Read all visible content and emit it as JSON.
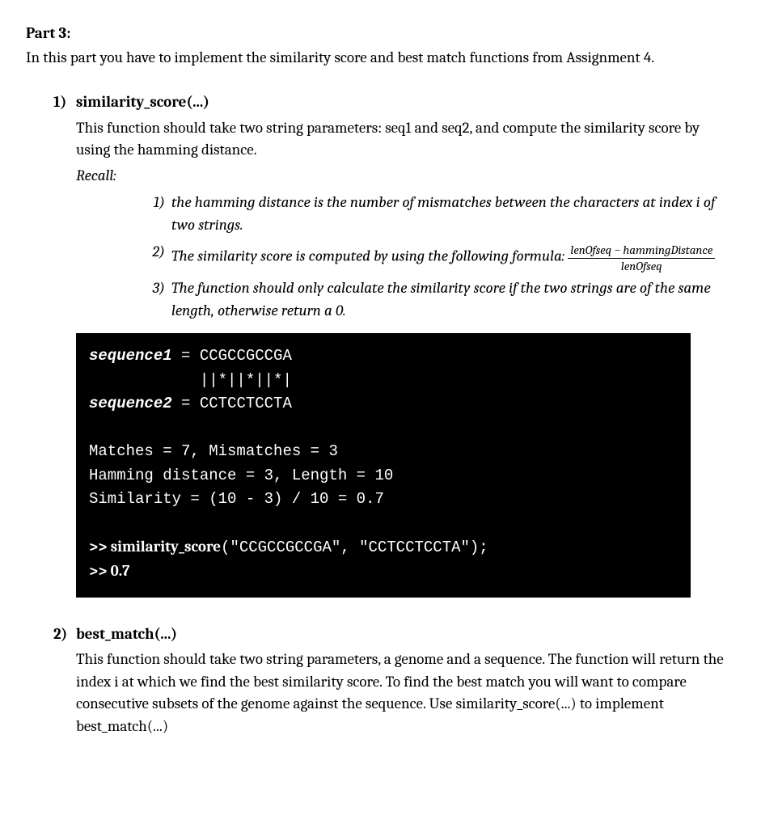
{
  "part": {
    "heading": "Part 3:",
    "intro": "In this part you have to implement the similarity score and best match functions from Assignment 4."
  },
  "items": [
    {
      "num": "1)",
      "title": "similarity_score(...)",
      "body": "This function should take two string parameters: seq1 and seq2, and compute the similarity score by using the hamming distance.",
      "recall": "Recall:",
      "inner": [
        {
          "num": "1)",
          "text": "the hamming distance is the number of mismatches between the characters at index i of two strings."
        },
        {
          "num": "2)",
          "text": "The similarity score is computed by using the following formula:",
          "formula_top": "lenOfseq − hammingDistance",
          "formula_bot": "lenOfseq"
        },
        {
          "num": "3)",
          "text": "The function should only calculate the similarity score if the two strings are of the same length, otherwise return a 0."
        }
      ],
      "code": {
        "seq1_label": "sequence1",
        "seq1_val": " = CCGCCGCCGA",
        "align": "            ||*||*||*|",
        "seq2_label": "sequence2",
        "seq2_val": " = CCTCCTCCTA",
        "m_line": "Matches = 7, Mismatches = 3",
        "h_line": "Hamming distance = 3, Length = 10",
        "s_line": "Similarity = (10 - 3) / 10 = 0.7",
        "call_prompt": ">> ",
        "call_fn": "similarity_score",
        "call_args": "(\"CCGCCGCCGA\", \"CCTCCTCCTA\");",
        "result": ">> 0.7"
      }
    },
    {
      "num": "2)",
      "title": "best_match(...)",
      "body": "This function should take two string parameters, a genome and a sequence. The function will return the index i at which we find the best similarity score. To find the best match you will want to compare consecutive subsets of the genome against the sequence. Use similarity_score(...) to implement best_match(...)"
    }
  ]
}
